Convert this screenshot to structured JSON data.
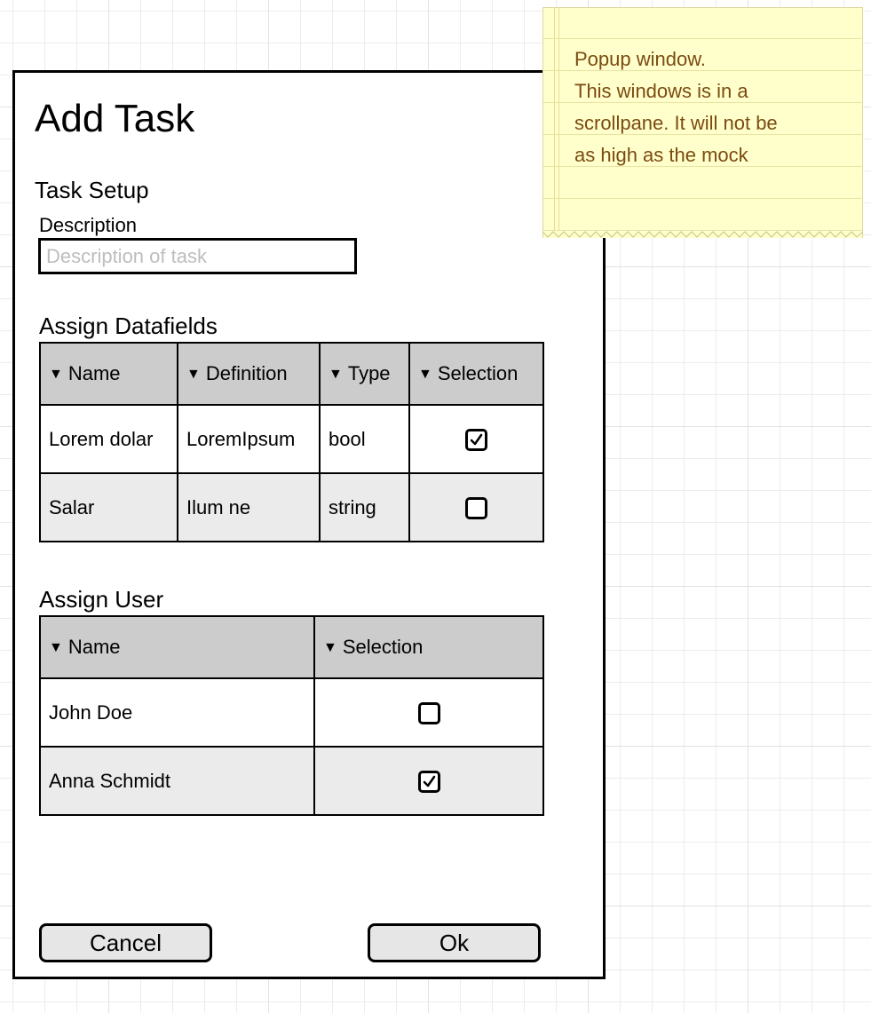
{
  "dialog": {
    "title": "Add Task",
    "task_setup_label": "Task Setup",
    "description": {
      "label": "Description",
      "value": "",
      "placeholder": "Description of task"
    },
    "datafields": {
      "section_label": "Assign Datafields",
      "columns": [
        "Name",
        "Definition",
        "Type",
        "Selection"
      ],
      "rows": [
        {
          "name": "Lorem dolar",
          "definition": "LoremIpsum",
          "type": "bool",
          "selected": true
        },
        {
          "name": "Salar",
          "definition": "Ilum ne",
          "type": "string",
          "selected": false
        }
      ]
    },
    "users": {
      "section_label": "Assign User",
      "columns": [
        "Name",
        "Selection"
      ],
      "rows": [
        {
          "name": "John Doe",
          "selected": false
        },
        {
          "name": "Anna Schmidt",
          "selected": true
        }
      ]
    },
    "buttons": {
      "cancel": "Cancel",
      "ok": "Ok"
    }
  },
  "sticky_note": {
    "lines": [
      "Popup window.",
      "This windows is in a",
      "scrollpane. It will not be",
      "as high as the mock"
    ]
  },
  "colors": {
    "header_bg": "#cccccc",
    "alt_row_bg": "#ebebeb",
    "sticky_bg": "#ffffcc",
    "sticky_text": "#7b4b11",
    "button_bg": "#e6e6e6"
  },
  "icons": {
    "sort": "triangle-down-icon",
    "checked": "checkbox-checked-icon",
    "unchecked": "checkbox-unchecked-icon"
  }
}
